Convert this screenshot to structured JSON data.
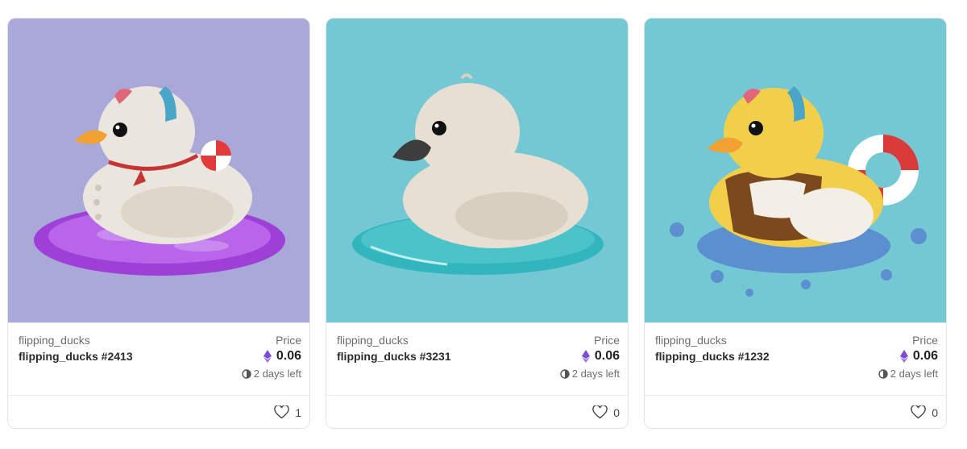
{
  "cards": [
    {
      "collection": "flipping_ducks",
      "name": "flipping_ducks #2413",
      "price_label": "Price",
      "price": "0.06",
      "time_left": "2 days left",
      "likes": "1",
      "bg": "#aaa8d8"
    },
    {
      "collection": "flipping_ducks",
      "name": "flipping_ducks #3231",
      "price_label": "Price",
      "price": "0.06",
      "time_left": "2 days left",
      "likes": "0",
      "bg": "#74c8d4"
    },
    {
      "collection": "flipping_ducks",
      "name": "flipping_ducks #1232",
      "price_label": "Price",
      "price": "0.06",
      "time_left": "2 days left",
      "likes": "0",
      "bg": "#74c8d4"
    }
  ],
  "icons": {
    "currency": "eth-icon",
    "timer": "clock-icon",
    "like": "heart-icon"
  }
}
